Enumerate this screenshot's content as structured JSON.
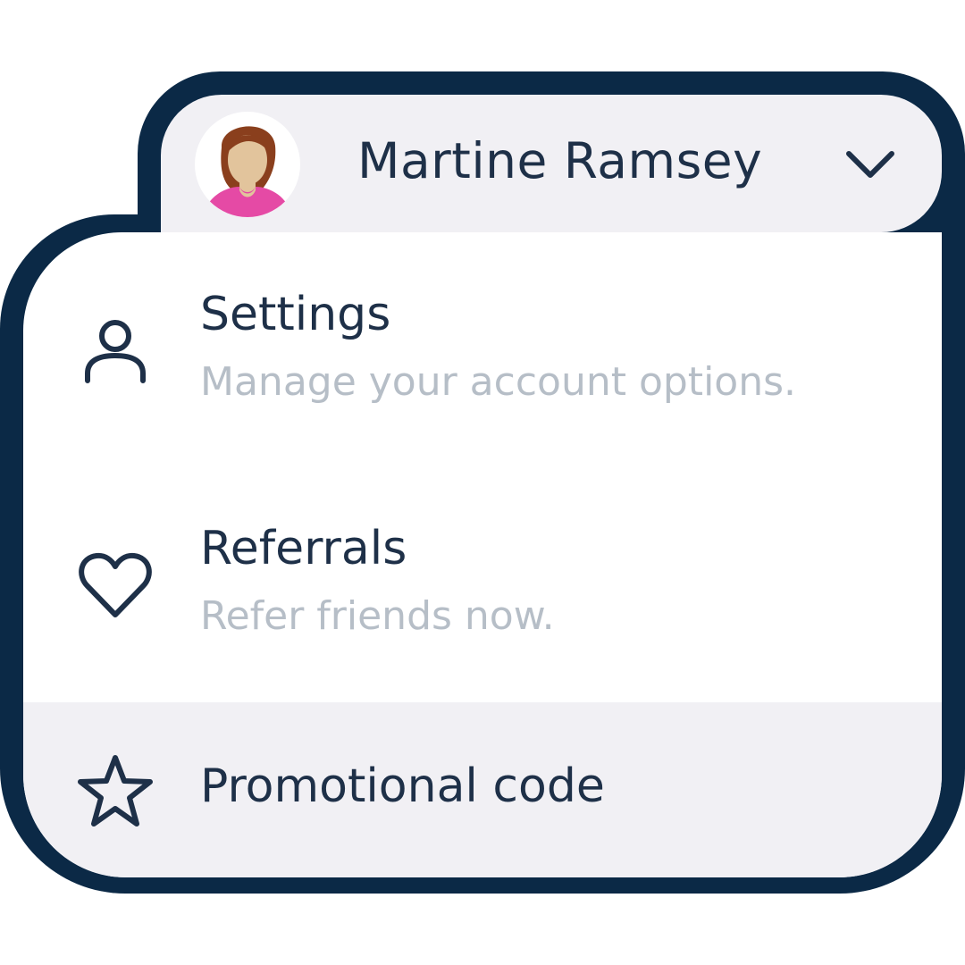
{
  "user": {
    "name": "Martine Ramsey"
  },
  "menu": {
    "items": [
      {
        "icon": "user-icon",
        "title": "Settings",
        "description": "Manage your account options."
      },
      {
        "icon": "heart-icon",
        "title": "Referrals",
        "description": "Refer friends now."
      },
      {
        "icon": "star-icon",
        "title": "Promotional code"
      }
    ]
  },
  "colors": {
    "outline": "#0b2946",
    "text": "#1e3048",
    "muted_text": "#b6bec7",
    "panel": "#f1f0f4",
    "avatar_hair": "#8a3f1d",
    "avatar_skin": "#e2c49c",
    "avatar_shirt": "#e54aa5"
  }
}
